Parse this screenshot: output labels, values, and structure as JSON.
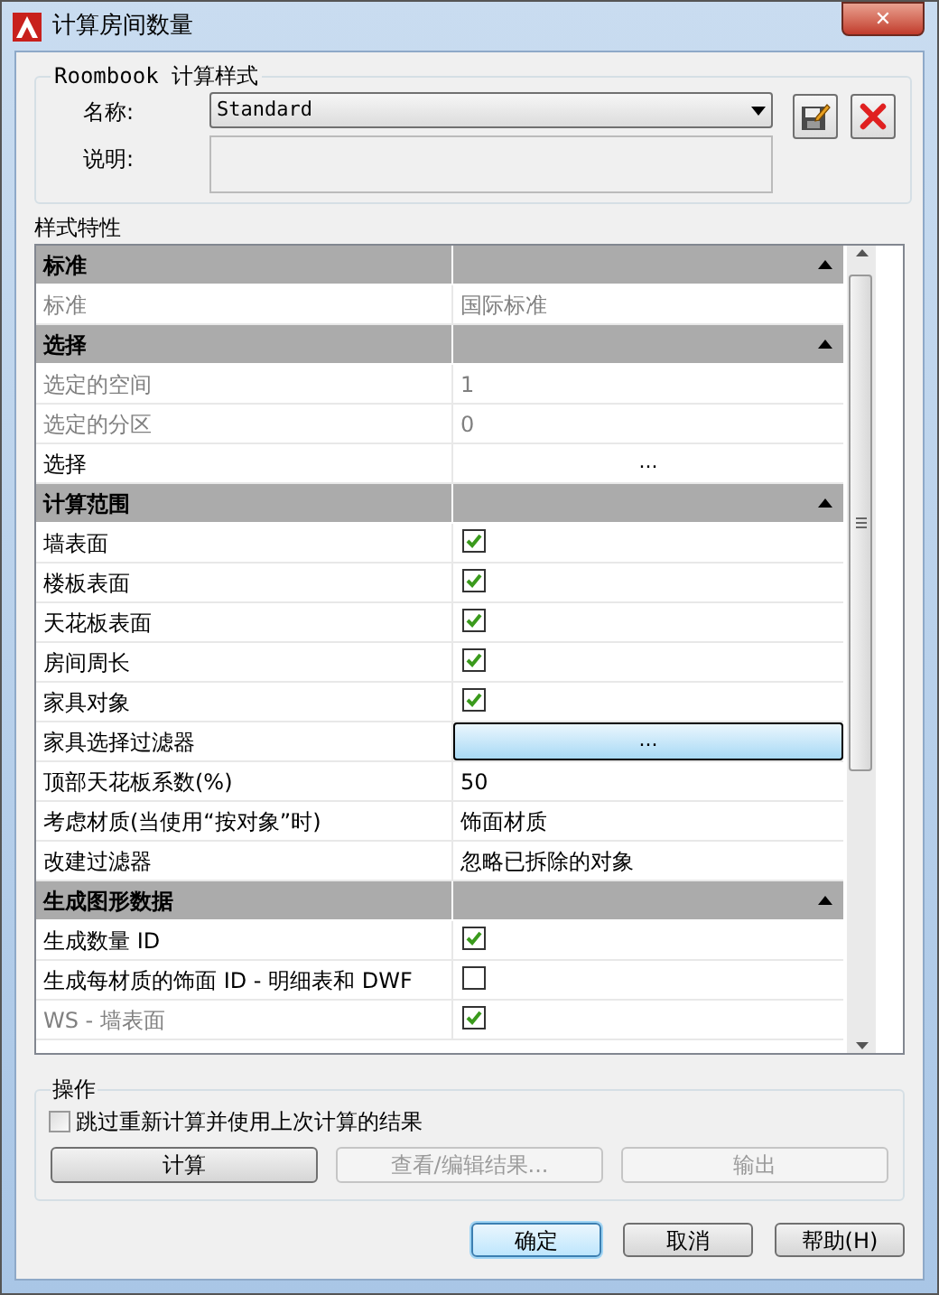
{
  "window": {
    "title": "计算房间数量",
    "close": "✕"
  },
  "style_group": {
    "title": "Roombook 计算样式",
    "name_label": "名称:",
    "name_value": "Standard",
    "description_label": "说明:"
  },
  "properties": {
    "title": "样式特性",
    "rows": [
      {
        "kind": "section",
        "label": "标准",
        "expanded": true
      },
      {
        "kind": "text",
        "label": "标准",
        "value": "国际标准",
        "disabled": true
      },
      {
        "kind": "section",
        "label": "选择",
        "expanded": true
      },
      {
        "kind": "text",
        "label": "选定的空间",
        "value": "1",
        "disabled": true
      },
      {
        "kind": "text",
        "label": "选定的分区",
        "value": "0",
        "disabled": true
      },
      {
        "kind": "ellipsis",
        "label": "选择",
        "value": "...",
        "disabled": false,
        "selected": false
      },
      {
        "kind": "section",
        "label": "计算范围",
        "expanded": true
      },
      {
        "kind": "check",
        "label": "墙表面",
        "checked": true,
        "disabled": false
      },
      {
        "kind": "check",
        "label": "楼板表面",
        "checked": true,
        "disabled": false
      },
      {
        "kind": "check",
        "label": "天花板表面",
        "checked": true,
        "disabled": false
      },
      {
        "kind": "check",
        "label": "房间周长",
        "checked": true,
        "disabled": false
      },
      {
        "kind": "check",
        "label": "家具对象",
        "checked": true,
        "disabled": false
      },
      {
        "kind": "ellipsis",
        "label": "家具选择过滤器",
        "value": "...",
        "disabled": false,
        "selected": true
      },
      {
        "kind": "text",
        "label": "顶部天花板系数(%)",
        "value": "50",
        "disabled": false
      },
      {
        "kind": "text",
        "label": "考虑材质(当使用“按对象”时)",
        "value": "饰面材质",
        "disabled": false
      },
      {
        "kind": "text",
        "label": "改建过滤器",
        "value": "忽略已拆除的对象",
        "disabled": false
      },
      {
        "kind": "section",
        "label": "生成图形数据",
        "expanded": true
      },
      {
        "kind": "check",
        "label": "生成数量 ID",
        "checked": true,
        "disabled": false
      },
      {
        "kind": "check",
        "label": "生成每材质的饰面 ID  - 明细表和 DWF",
        "checked": false,
        "disabled": false
      },
      {
        "kind": "check",
        "label": "WS - 墙表面",
        "checked": true,
        "disabled": true
      }
    ]
  },
  "operations": {
    "title": "操作",
    "skip_checkbox": {
      "label": "跳过重新计算并使用上次计算的结果",
      "checked": false
    },
    "buttons": [
      {
        "label": "计算",
        "disabled": false
      },
      {
        "label": "查看/编辑结果...",
        "disabled": true
      },
      {
        "label": "输出",
        "disabled": true
      }
    ]
  },
  "dialog_buttons": [
    {
      "label": "确定",
      "default": true
    },
    {
      "label": "取消",
      "default": false
    },
    {
      "label": "帮助(H)",
      "default": false
    }
  ]
}
